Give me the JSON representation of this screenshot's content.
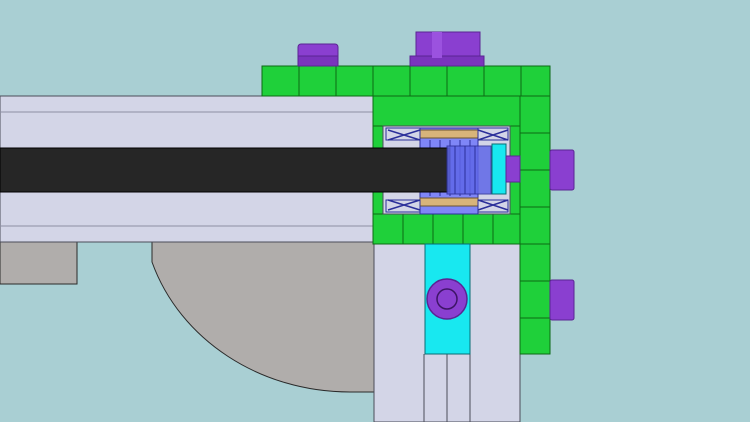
{
  "scene": {
    "description_free": true,
    "colors": {
      "background": "#a9cfd3",
      "green_plate": "#1fd03a",
      "green_edge": "#0c6a14",
      "purple_part": "#8a3fd0",
      "purple_dark": "#5b2493",
      "extrusion_light": "#d3d5e7",
      "extrusion_edge": "#4b4d5a",
      "black_bar": "#262626",
      "gray_shape": "#b0adab",
      "cyan_part": "#18e8f0",
      "bearing_blue": "#6a70f0",
      "bearing_tan": "#d8b47a"
    },
    "icons": [
      "bolt-head-icon",
      "pulley-icon",
      "shaft-icon",
      "nut-icon",
      "bearing-icon",
      "bolt-socket-icon"
    ]
  }
}
